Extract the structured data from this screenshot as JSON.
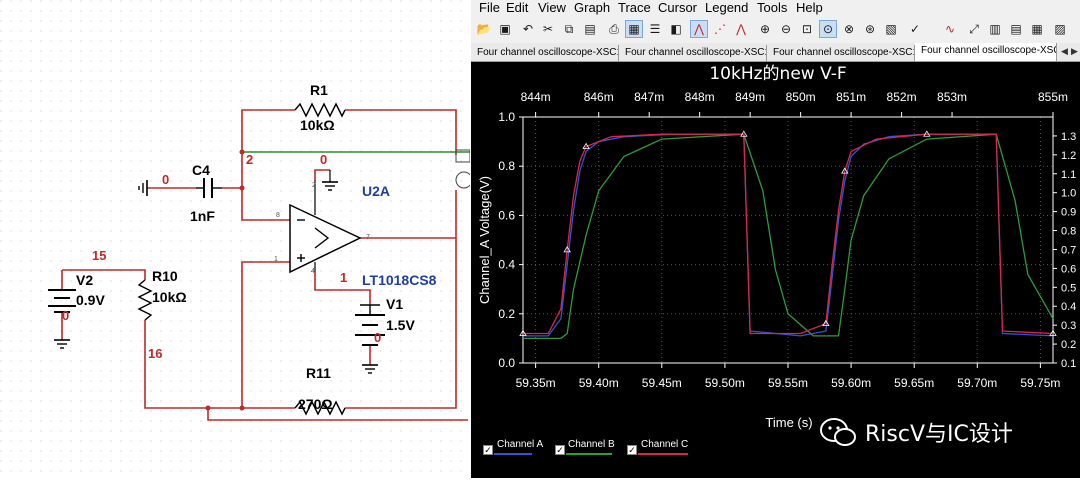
{
  "schematic": {
    "components": {
      "r1": {
        "ref": "R1",
        "value": "10kΩ"
      },
      "c4": {
        "ref": "C4",
        "value": "1nF"
      },
      "u2a": {
        "ref": "U2A",
        "part": "LT1018CS8"
      },
      "v2": {
        "ref": "V2",
        "value": "0.9V"
      },
      "r10": {
        "ref": "R10",
        "value": "10kΩ"
      },
      "v1": {
        "ref": "V1",
        "value": "1.5V"
      },
      "r11": {
        "ref": "R11",
        "value": "270Ω"
      }
    },
    "nets": {
      "n2": "2",
      "n0a": "0",
      "n0b": "0",
      "n0c": "0",
      "n0d": "0",
      "n15": "15",
      "n16": "16",
      "n1": "1"
    },
    "pins": {
      "p8": "8",
      "p2": "2",
      "p1": "1",
      "p7": "7",
      "p3": "3",
      "p4": "4"
    },
    "colors": {
      "wire": "#c0282a",
      "wire_green": "#2e8b2e",
      "netlabel": "#c0282a",
      "opamp_label": "#1f3f9f"
    }
  },
  "grapher": {
    "menu": [
      "File",
      "Edit",
      "View",
      "Graph",
      "Trace",
      "Cursor",
      "Legend",
      "Tools",
      "Help"
    ],
    "toolbar_icons": [
      "open-icon",
      "save-icon",
      "undo-icon",
      "cut-icon",
      "copy-icon",
      "paste-icon",
      "print-icon",
      "grid-icon",
      "legend-icon",
      "overlay-icon",
      "trace-icon",
      "cursor-icon",
      "cursor2-icon",
      "zoom-in-icon",
      "zoom-out-icon",
      "zoom-fit-icon",
      "zoom-area-icon",
      "zoom-x-icon",
      "zoom-y-icon",
      "properties-icon",
      "graph-icon",
      "export-icon",
      "export2-icon",
      "copy-graph-icon"
    ],
    "tabs": [
      "Four channel oscilloscope-XSC1",
      "Four channel oscilloscope-XSC1",
      "Four channel oscilloscope-XSC1",
      "Four channel oscilloscope-XSC"
    ],
    "active_tab": 3,
    "watermark": "RiscV与IC设计",
    "colors": {
      "channel_a": "#3b4fd6",
      "channel_b": "#2e9b3a",
      "channel_c": "#d6284a",
      "background": "#000000",
      "grid": "#555555"
    }
  },
  "chart_data": {
    "type": "line",
    "title": "10kHz的new V-F",
    "xlabel": "Time (s)",
    "ylabel": "Channel_A Voltage(V)",
    "xlim": [
      0.05934,
      0.05976
    ],
    "ylim": [
      0,
      1.0
    ],
    "y2lim": [
      0.1,
      1.4
    ],
    "x_ticks_bottom": [
      "59.35m",
      "59.40m",
      "59.45m",
      "59.50m",
      "59.55m",
      "59.60m",
      "59.65m",
      "59.70m",
      "59.75m"
    ],
    "x_ticks_bottom_values": [
      0.05935,
      0.0594,
      0.05945,
      0.0595,
      0.05955,
      0.0596,
      0.05965,
      0.0597,
      0.05975
    ],
    "x_ticks_top": [
      "844m",
      "846m",
      "847m",
      "848m",
      "849m",
      "850m",
      "851m",
      "852m",
      "853m",
      "855m"
    ],
    "x_ticks_top_values": [
      0.05935,
      0.0594,
      0.05944,
      0.05948,
      0.05952,
      0.05956,
      0.0596,
      0.05964,
      0.05968,
      0.05976
    ],
    "y_ticks_left": [
      "0.0",
      "0.2",
      "0.4",
      "0.6",
      "0.8",
      "1.0"
    ],
    "y_ticks_left_values": [
      0,
      0.2,
      0.4,
      0.6,
      0.8,
      1.0
    ],
    "y_ticks_right": [
      "0.1",
      "0.2",
      "0.3",
      "0.4",
      "0.5",
      "0.6",
      "0.7",
      "0.8",
      "0.9",
      "1.0",
      "1.1",
      "1.2",
      "1.3"
    ],
    "y_ticks_right_values": [
      0.1,
      0.2,
      0.3,
      0.4,
      0.5,
      0.6,
      0.7,
      0.8,
      0.9,
      1.0,
      1.1,
      1.2,
      1.3
    ],
    "grid": true,
    "legend": "bottom-left",
    "series": [
      {
        "name": "Channel A",
        "color": "#3b4fd6",
        "points": [
          [
            0.05934,
            0.11
          ],
          [
            0.05936,
            0.11
          ],
          [
            0.05937,
            0.18
          ],
          [
            0.059375,
            0.4
          ],
          [
            0.05938,
            0.62
          ],
          [
            0.059385,
            0.78
          ],
          [
            0.05939,
            0.86
          ],
          [
            0.0594,
            0.9
          ],
          [
            0.05942,
            0.92
          ],
          [
            0.05946,
            0.93
          ],
          [
            0.059515,
            0.93
          ],
          [
            0.05952,
            0.13
          ],
          [
            0.05956,
            0.11
          ],
          [
            0.05958,
            0.13
          ],
          [
            0.059585,
            0.35
          ],
          [
            0.05959,
            0.58
          ],
          [
            0.059595,
            0.74
          ],
          [
            0.0596,
            0.84
          ],
          [
            0.05961,
            0.89
          ],
          [
            0.05963,
            0.92
          ],
          [
            0.05966,
            0.93
          ],
          [
            0.059715,
            0.93
          ],
          [
            0.05972,
            0.12
          ],
          [
            0.05976,
            0.11
          ]
        ]
      },
      {
        "name": "Channel B",
        "color": "#2e9b3a",
        "points": [
          [
            0.05934,
            0.1
          ],
          [
            0.05937,
            0.1
          ],
          [
            0.059375,
            0.12
          ],
          [
            0.05938,
            0.3
          ],
          [
            0.05939,
            0.52
          ],
          [
            0.0594,
            0.7
          ],
          [
            0.05942,
            0.84
          ],
          [
            0.05945,
            0.91
          ],
          [
            0.059515,
            0.93
          ],
          [
            0.05953,
            0.7
          ],
          [
            0.05954,
            0.38
          ],
          [
            0.05955,
            0.2
          ],
          [
            0.05957,
            0.11
          ],
          [
            0.05959,
            0.11
          ],
          [
            0.059595,
            0.3
          ],
          [
            0.0596,
            0.5
          ],
          [
            0.05961,
            0.68
          ],
          [
            0.05963,
            0.83
          ],
          [
            0.05966,
            0.91
          ],
          [
            0.059715,
            0.93
          ],
          [
            0.05973,
            0.66
          ],
          [
            0.05974,
            0.36
          ],
          [
            0.05976,
            0.18
          ]
        ]
      },
      {
        "name": "Channel C",
        "color": "#d6284a",
        "points": [
          [
            0.05934,
            0.12
          ],
          [
            0.05936,
            0.12
          ],
          [
            0.05937,
            0.22
          ],
          [
            0.059375,
            0.46
          ],
          [
            0.05938,
            0.68
          ],
          [
            0.059385,
            0.82
          ],
          [
            0.05939,
            0.88
          ],
          [
            0.05941,
            0.92
          ],
          [
            0.05945,
            0.93
          ],
          [
            0.059515,
            0.93
          ],
          [
            0.05952,
            0.12
          ],
          [
            0.05956,
            0.12
          ],
          [
            0.05958,
            0.16
          ],
          [
            0.059585,
            0.4
          ],
          [
            0.05959,
            0.62
          ],
          [
            0.059595,
            0.78
          ],
          [
            0.0596,
            0.86
          ],
          [
            0.05962,
            0.91
          ],
          [
            0.05966,
            0.93
          ],
          [
            0.059715,
            0.93
          ],
          [
            0.05972,
            0.13
          ],
          [
            0.05976,
            0.12
          ]
        ]
      }
    ]
  }
}
